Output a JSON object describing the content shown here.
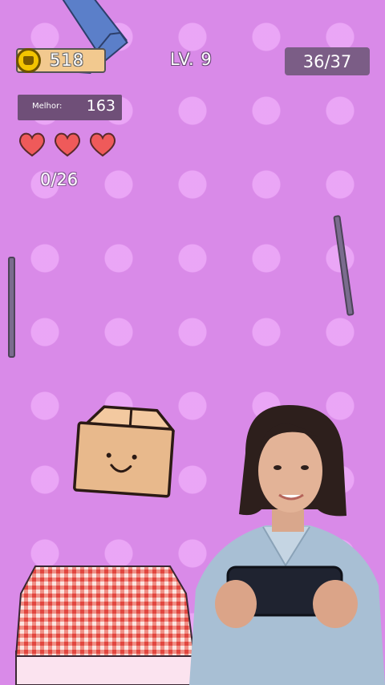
{
  "hud": {
    "coins": "518",
    "level": "LV. 9",
    "progress": "36/37",
    "best_label": "Melhor:",
    "best_value": "163",
    "lives": 3,
    "collected": "0/26"
  },
  "icons": {
    "coin": "cat-coin-icon",
    "life": "heart-icon"
  },
  "colors": {
    "background": "#d98ae8",
    "ribbon": "#5b7fc9",
    "heart": "#ef5a5a",
    "box": "#e8b98c",
    "tablecloth": "#e85a5a"
  }
}
